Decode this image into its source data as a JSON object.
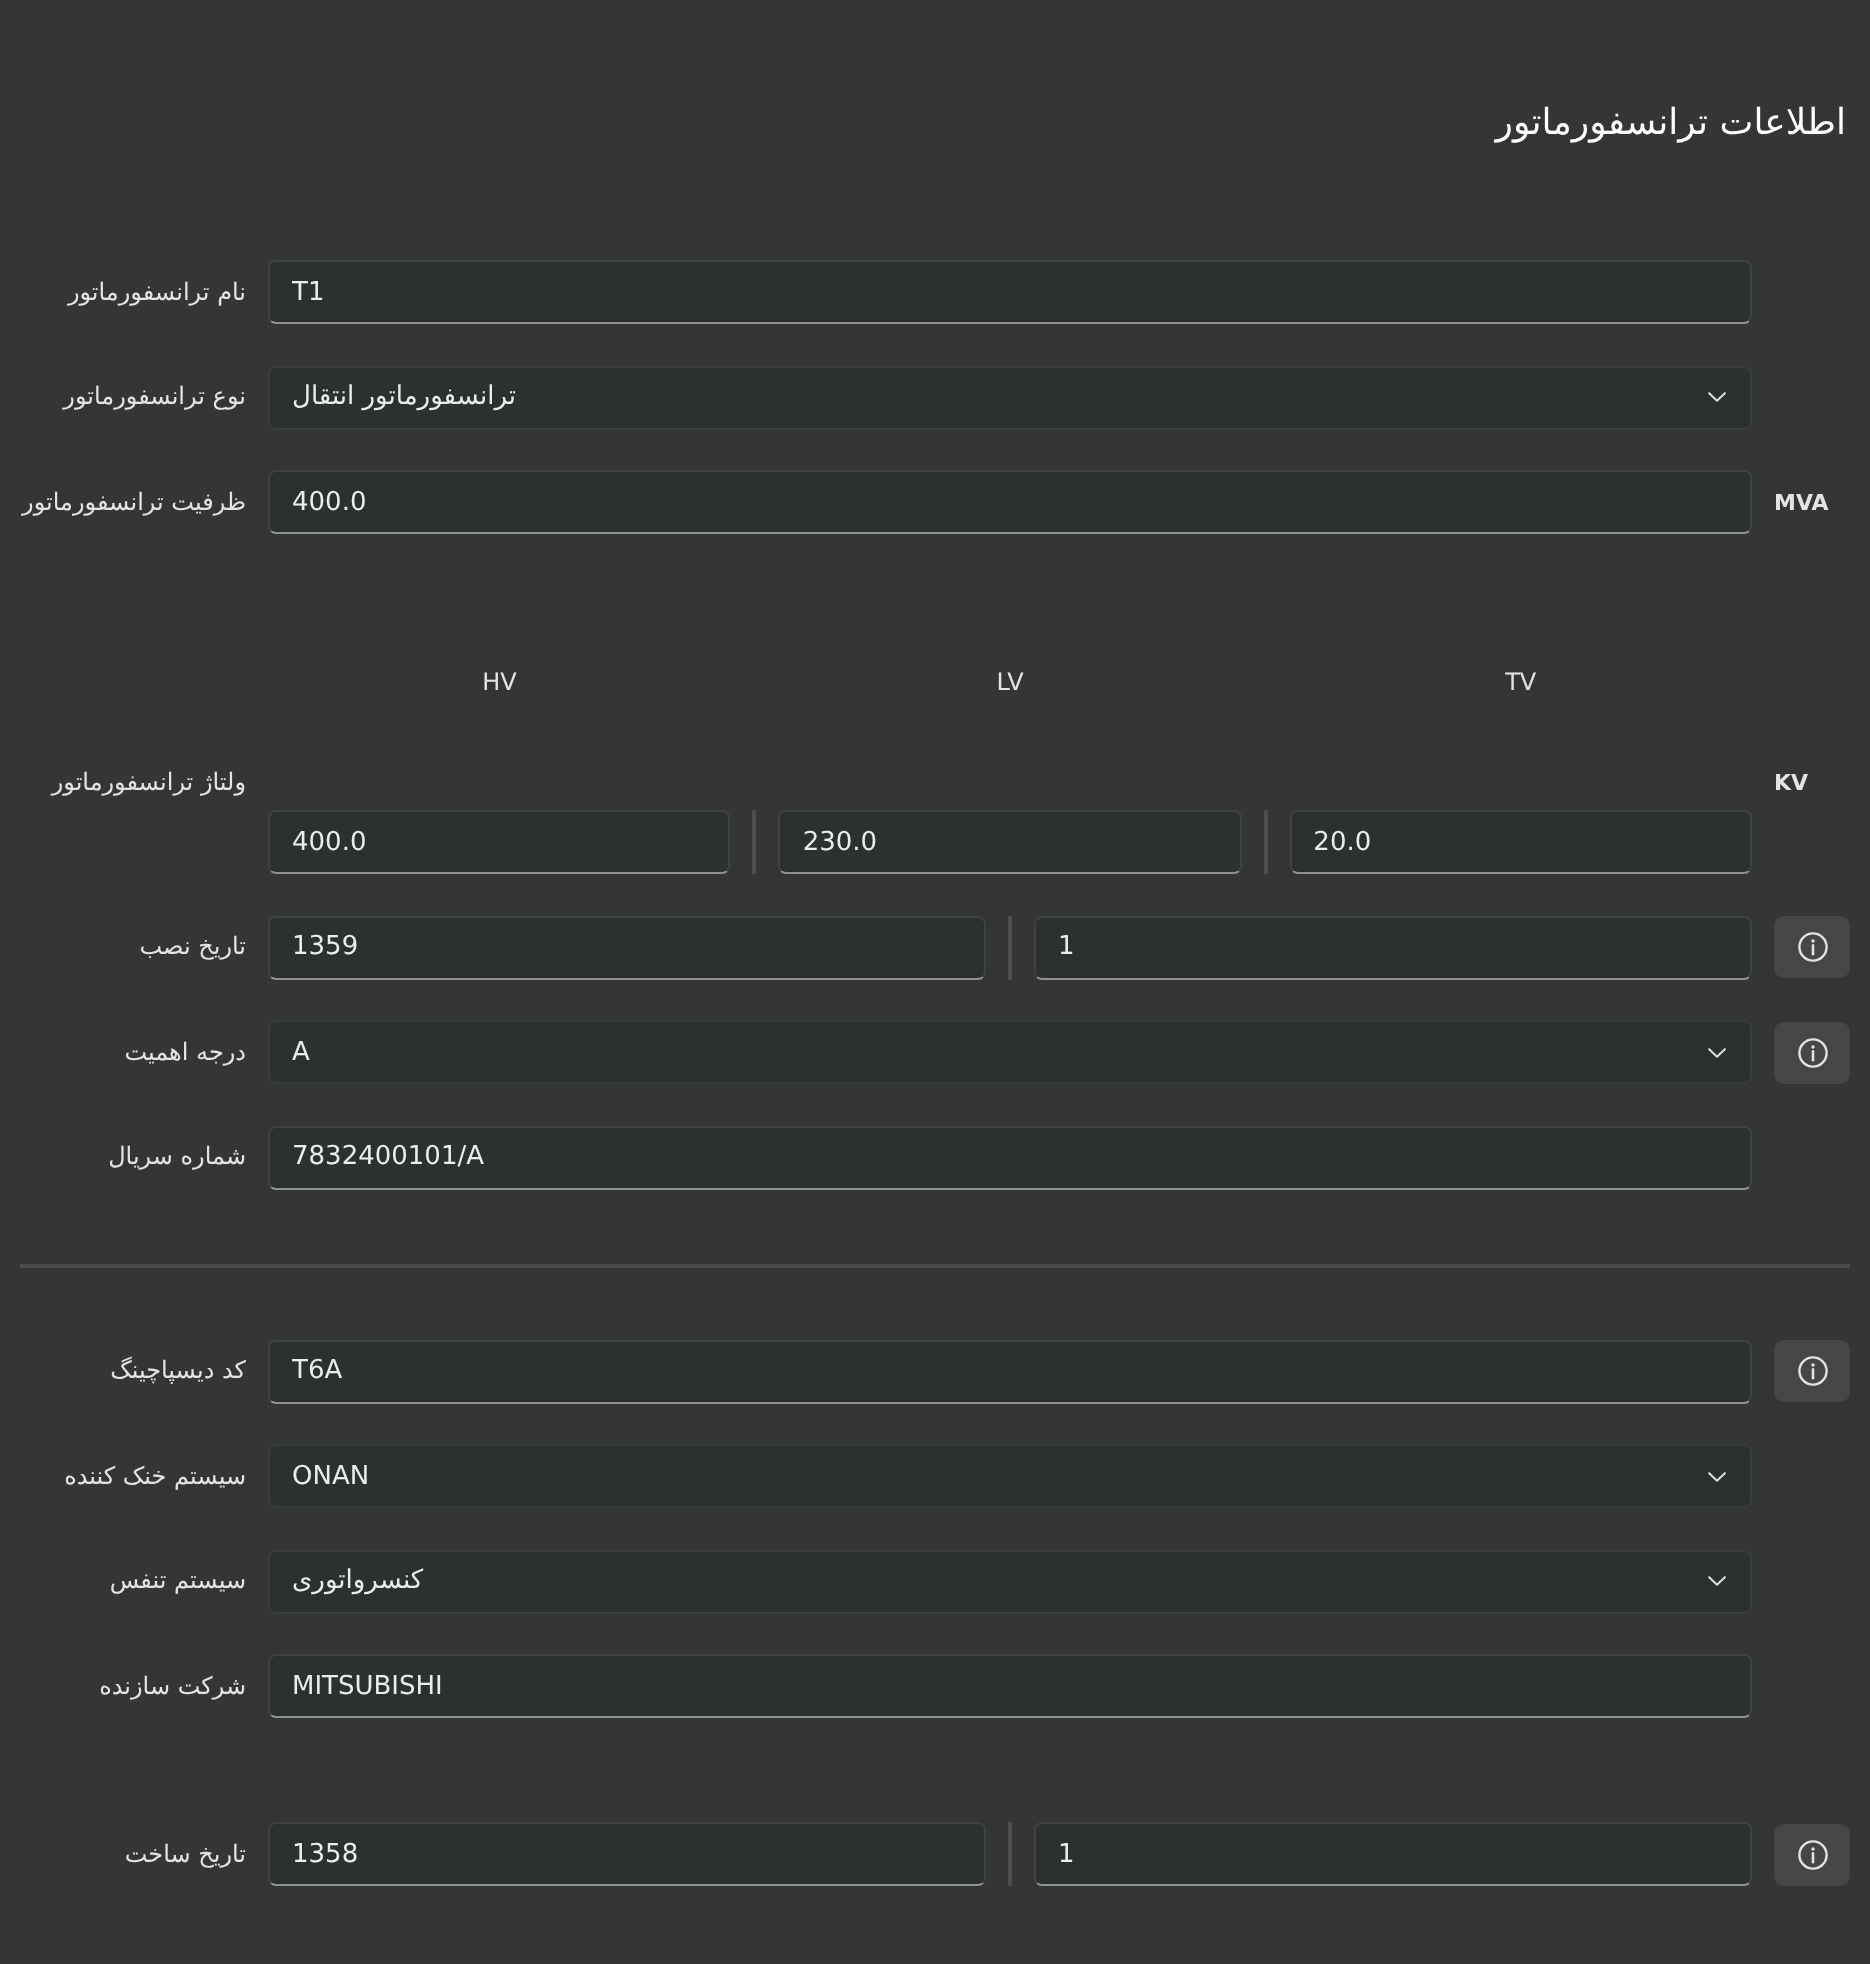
{
  "title": "اطلاعات ترانسفورماتور",
  "sections": [
    {
      "groups": [
        {
          "fields": [
            {
              "kind": "text",
              "label": "نام ترانسفورماتور",
              "value": "T1",
              "info": false
            },
            {
              "kind": "select",
              "label": "نوع ترانسفورماتور",
              "value": "ترانسفورماتور انتقال",
              "info": false
            },
            {
              "kind": "text",
              "label": "ظرفیت ترانسفورماتور",
              "value": "400.0",
              "unit": "MVA",
              "info": false
            }
          ]
        },
        {
          "fields": [
            {
              "kind": "split",
              "label": "ولتاژ ترانسفورماتور",
              "unit": "KV",
              "info": false,
              "parts": [
                {
                  "heading": "TV",
                  "value": "20.0"
                },
                {
                  "heading": "LV",
                  "value": "230.0"
                },
                {
                  "heading": "HV",
                  "value": "400.0"
                }
              ]
            },
            {
              "kind": "split",
              "label": "تاریخ نصب",
              "info": true,
              "parts": [
                {
                  "value": "1"
                },
                {
                  "value": "1359"
                }
              ]
            },
            {
              "kind": "select",
              "label": "درجه اهمیت",
              "value": "A",
              "info": true
            },
            {
              "kind": "text",
              "label": "شماره سریال",
              "value": "7832400101/A",
              "info": false
            }
          ]
        }
      ]
    },
    {
      "groups": [
        {
          "fields": [
            {
              "kind": "text",
              "label": "کد دیسپاچینگ",
              "value": "T6A",
              "info": true
            },
            {
              "kind": "select",
              "label": "سیستم خنک کننده",
              "value": "ONAN",
              "info": false
            },
            {
              "kind": "select",
              "label": "سیستم تنفس",
              "value": "کنسرواتوری",
              "info": false
            },
            {
              "kind": "text",
              "label": "شرکت سازنده",
              "value": "MITSUBISHI",
              "info": false
            }
          ]
        },
        {
          "fields": [
            {
              "kind": "split",
              "label": "تاریخ ساخت",
              "info": true,
              "parts": [
                {
                  "value": "1"
                },
                {
                  "value": "1358"
                }
              ]
            }
          ]
        }
      ]
    }
  ]
}
